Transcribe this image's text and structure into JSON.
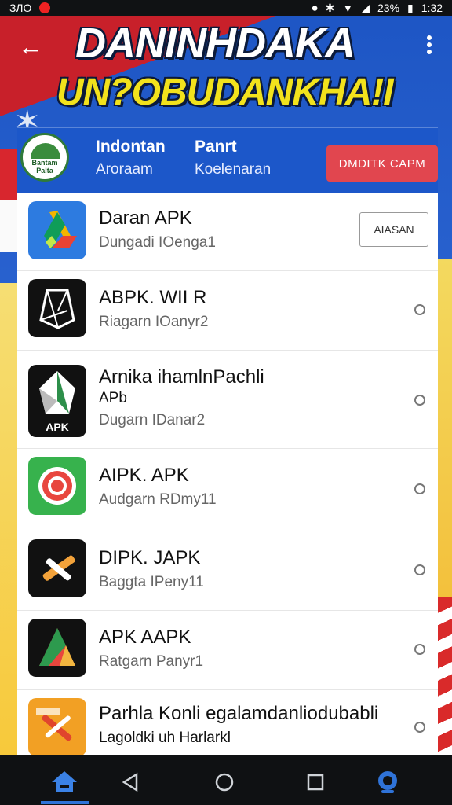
{
  "status_bar": {
    "left_text": "ЗЛО",
    "right_battery": "23%",
    "time": "1:32"
  },
  "header": {
    "title_line1": "DANINHDAKA",
    "title_line2": "UN?OBUDANKHA!I"
  },
  "profile": {
    "logo_text": "Bantam Palta",
    "col1_title": "Indontan",
    "col1_sub": "Aroraam",
    "col2_title": "Panrt",
    "col2_sub": "Koelenaran",
    "cta_label": "DMDITK CAPM"
  },
  "apps": [
    {
      "name": "Daran APK",
      "sub": "Dungadi IOenga1",
      "action": "AIASAN"
    },
    {
      "name": "ABPK. WII R",
      "sub": "Riagarn IOanyr2"
    },
    {
      "name": "Arnika ihamlnPachli",
      "name2": "APb",
      "sub": "Dugarn IDanar2"
    },
    {
      "name": "AIPK. APK",
      "sub": "Audgarn RDmy11"
    },
    {
      "name": "DIPK. JAPK",
      "sub": "Baggta IPeny11"
    },
    {
      "name": "APK AAPK",
      "sub": "Ratgarn Panyr1"
    },
    {
      "name": "Parhla Konli egalamdanliodubabli",
      "sub": "Lagoldki uh Harlarkl"
    }
  ],
  "colors": {
    "accent_blue": "#1c57c9",
    "cta_red": "#e1464f",
    "title_yellow": "#f2e21c"
  }
}
